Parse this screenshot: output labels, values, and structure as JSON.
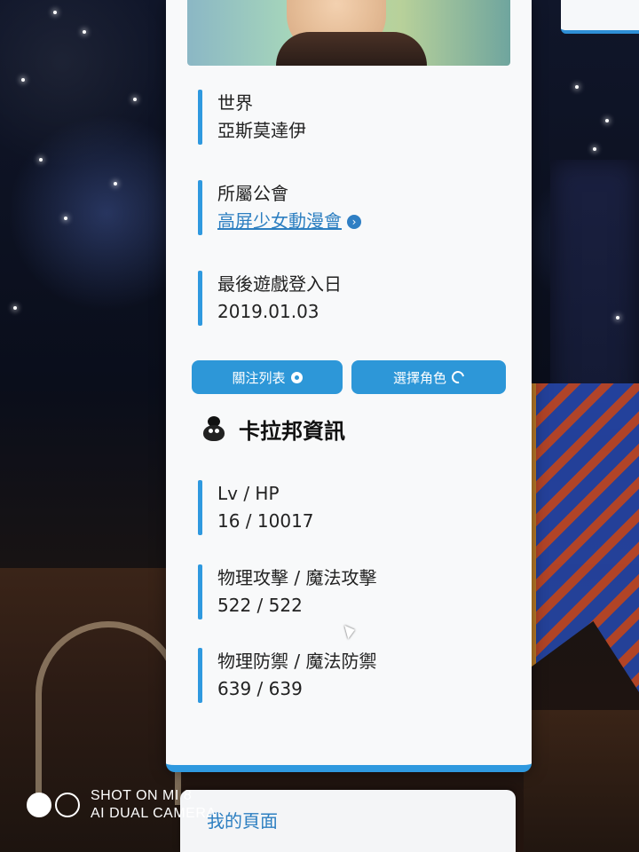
{
  "profile": {
    "world_label": "世界",
    "world_value": "亞斯莫達伊",
    "guild_label": "所屬公會",
    "guild_value": "高屏少女動漫會",
    "last_login_label": "最後遊戲登入日",
    "last_login_value": "2019.01.03"
  },
  "actions": {
    "follow_list": "關注列表",
    "select_character": "選擇角色"
  },
  "section": {
    "title": "卡拉邦資訊"
  },
  "stats": [
    {
      "label": "Lv / HP",
      "value": "16 / 10017"
    },
    {
      "label": "物理攻擊 / 魔法攻擊",
      "value": "522 / 522"
    },
    {
      "label": "物理防禦 / 魔法防禦",
      "value": "639 / 639"
    }
  ],
  "footer": {
    "my_page": "我的頁面"
  },
  "watermark": {
    "line1": "SHOT ON MI 8",
    "line2": "AI DUAL CAMERA"
  },
  "icons": {
    "follow": "follow-icon",
    "refresh": "refresh-icon",
    "arrow": "arrow-right-circle-icon",
    "pet": "pet-icon"
  },
  "colors": {
    "accent": "#2f99df",
    "link": "#2d7fc1",
    "card_bg": "#f8f9fa"
  }
}
